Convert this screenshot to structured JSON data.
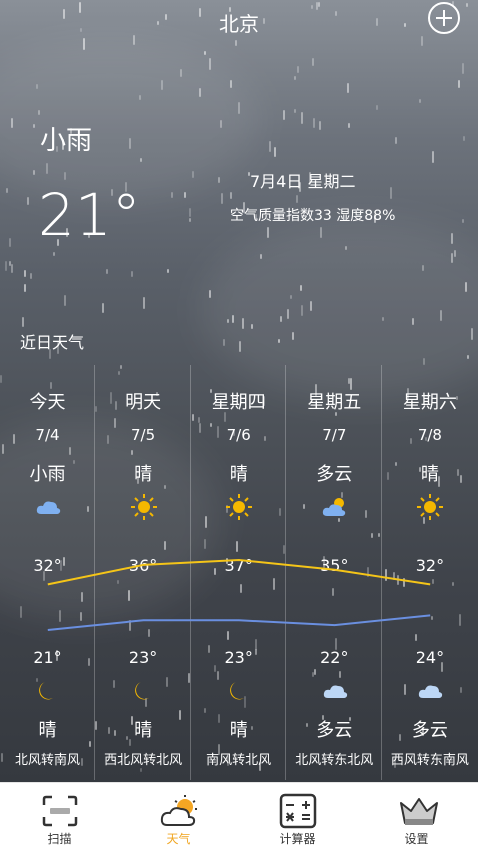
{
  "header": {
    "city": "北京"
  },
  "current": {
    "condition": "小雨",
    "temperature": "21°",
    "date": "7月4日 星期二",
    "air_humidity": "空气质量指数33 湿度88%"
  },
  "section_title": "近日天气",
  "days": [
    {
      "name": "今天",
      "date": "7/4",
      "day_cond": "小雨",
      "day_icon": "rain-cloud-icon",
      "high": "32°",
      "low": "21°",
      "night_icon": "moon-icon",
      "night_cond": "晴",
      "wind": "北风转南风"
    },
    {
      "name": "明天",
      "date": "7/5",
      "day_cond": "晴",
      "day_icon": "sun-icon",
      "high": "36°",
      "low": "23°",
      "night_icon": "moon-icon",
      "night_cond": "晴",
      "wind": "西北风转北风"
    },
    {
      "name": "星期四",
      "date": "7/6",
      "day_cond": "晴",
      "day_icon": "sun-icon",
      "high": "37°",
      "low": "23°",
      "night_icon": "moon-icon",
      "night_cond": "晴",
      "wind": "南风转北风"
    },
    {
      "name": "星期五",
      "date": "7/7",
      "day_cond": "多云",
      "day_icon": "partly-cloudy-icon",
      "high": "35°",
      "low": "22°",
      "night_icon": "cloud-icon",
      "night_cond": "多云",
      "wind": "北风转东北风"
    },
    {
      "name": "星期六",
      "date": "7/8",
      "day_cond": "晴",
      "day_icon": "sun-icon",
      "high": "32°",
      "low": "24°",
      "night_icon": "cloud-icon",
      "night_cond": "多云",
      "wind": "西风转东南风"
    }
  ],
  "colors": {
    "high_line": "#f5c518",
    "low_line": "#6a8fe0",
    "accent": "#f0a520"
  },
  "tabs": [
    {
      "label": "扫描",
      "icon": "scan-icon"
    },
    {
      "label": "天气",
      "icon": "weather-icon"
    },
    {
      "label": "计算器",
      "icon": "calculator-icon"
    },
    {
      "label": "设置",
      "icon": "crown-icon"
    }
  ]
}
